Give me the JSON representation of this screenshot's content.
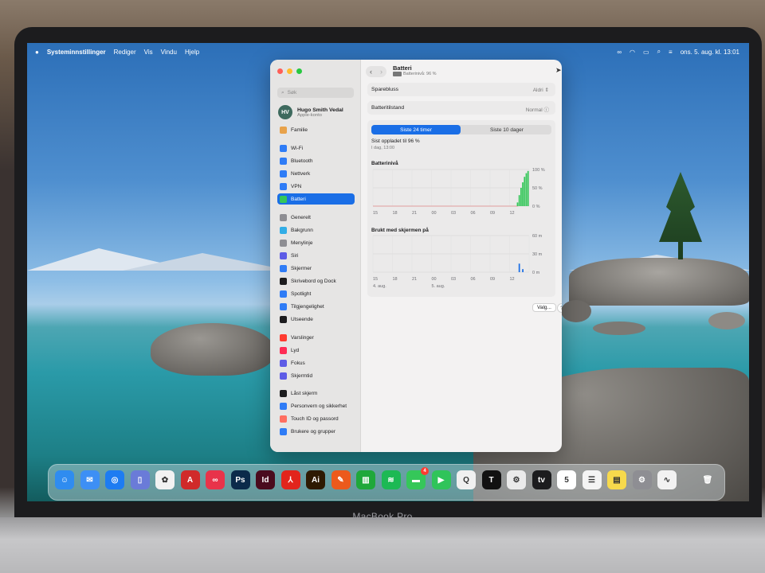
{
  "menubar": {
    "app_name": "Systeminnstillinger",
    "menus": [
      "Rediger",
      "Vis",
      "Vindu",
      "Hjelp"
    ],
    "datetime": "ons. 5. aug. kl. 13:01"
  },
  "sidebar": {
    "search_placeholder": "Søk",
    "user_name": "Hugo Smith Vedal",
    "user_sub": "Apple-konto",
    "avatar_initials": "HV",
    "items": [
      {
        "label": "Familie",
        "icon": "family-icon",
        "color": "#e8a24a"
      },
      {
        "label": "Wi-Fi",
        "icon": "wifi-icon",
        "color": "#2f7cf6"
      },
      {
        "label": "Bluetooth",
        "icon": "bluetooth-icon",
        "color": "#2f7cf6"
      },
      {
        "label": "Nettverk",
        "icon": "globe-icon",
        "color": "#2f7cf6"
      },
      {
        "label": "VPN",
        "icon": "vpn-icon",
        "color": "#2f7cf6"
      },
      {
        "label": "Batteri",
        "icon": "battery-icon",
        "color": "#34c759"
      },
      {
        "label": "Generelt",
        "icon": "gear-icon",
        "color": "#8e8e93"
      },
      {
        "label": "Bakgrunn",
        "icon": "wallpaper-icon",
        "color": "#32ade6"
      },
      {
        "label": "Menylinje",
        "icon": "menubar-icon",
        "color": "#8e8e93"
      },
      {
        "label": "Siri",
        "icon": "siri-icon",
        "color": "#5e5ce6"
      },
      {
        "label": "Skjermer",
        "icon": "display-icon",
        "color": "#2f7cf6"
      },
      {
        "label": "Skrivebord og Dock",
        "icon": "dock-icon",
        "color": "#1c1c1e"
      },
      {
        "label": "Spotlight",
        "icon": "spotlight-icon",
        "color": "#2f7cf6"
      },
      {
        "label": "Tilgjengelighet",
        "icon": "accessibility-icon",
        "color": "#2f7cf6"
      },
      {
        "label": "Utseende",
        "icon": "appearance-icon",
        "color": "#1c1c1e"
      },
      {
        "label": "Varslinger",
        "icon": "notifications-icon",
        "color": "#ff3b30"
      },
      {
        "label": "Lyd",
        "icon": "sound-icon",
        "color": "#ff2d55"
      },
      {
        "label": "Fokus",
        "icon": "focus-icon",
        "color": "#5e5ce6"
      },
      {
        "label": "Skjermtid",
        "icon": "screentime-icon",
        "color": "#5e5ce6"
      },
      {
        "label": "Låst skjerm",
        "icon": "lock-screen-icon",
        "color": "#1c1c1e"
      },
      {
        "label": "Personvern og sikkerhet",
        "icon": "privacy-icon",
        "color": "#2f7cf6"
      },
      {
        "label": "Touch ID og passord",
        "icon": "touchid-icon",
        "color": "#ff6f61"
      },
      {
        "label": "Brukere og grupper",
        "icon": "users-icon",
        "color": "#2f7cf6"
      }
    ]
  },
  "main": {
    "title": "Batteri",
    "subtitle": "Batterinivå: 96 %",
    "low_power_label": "Sparebluss",
    "low_power_value": "Aldri",
    "health_label": "Batteritilstand",
    "health_value": "Normal",
    "tab_24h": "Siste 24 timer",
    "tab_10d": "Siste 10 dager",
    "last_charged": "Sist oppladet til 96 %",
    "last_charged_time": "I dag, 13:00",
    "options_button": "Valg...",
    "help_button": "?"
  },
  "chart_data": [
    {
      "type": "bar",
      "title": "Batterinivå",
      "categories": [
        "15",
        "18",
        "21",
        "00",
        "03",
        "06",
        "09",
        "12"
      ],
      "yticks": [
        "100 %",
        "50 %",
        "0 %"
      ],
      "ylim": [
        0,
        100
      ],
      "series": [
        {
          "values": [
            0,
            0,
            0,
            0,
            0,
            0,
            0,
            0,
            0,
            0,
            0,
            0,
            0,
            0,
            0,
            0,
            0,
            0,
            0,
            0,
            0,
            0,
            0,
            0,
            0,
            0,
            0,
            0,
            0,
            0,
            0,
            0,
            0,
            0,
            0,
            0,
            0,
            0,
            0,
            0,
            0,
            0,
            0,
            0,
            0,
            0,
            0,
            0,
            0,
            0,
            0,
            0,
            0,
            0,
            0,
            0,
            0,
            0,
            0,
            0,
            0,
            0,
            0,
            0,
            0,
            0,
            0,
            0,
            0,
            0,
            0,
            0,
            0,
            0,
            0,
            0,
            0,
            0,
            0,
            0,
            0,
            0,
            10,
            30,
            50,
            65,
            80,
            90,
            96
          ]
        }
      ],
      "grid": true
    },
    {
      "type": "bar",
      "title": "Brukt med skjermen på",
      "categories": [
        "15",
        "18",
        "21",
        "00",
        "03",
        "06",
        "09",
        "12"
      ],
      "date_labels": [
        "4. aug.",
        "5. aug."
      ],
      "yticks": [
        "60 m",
        "30 m",
        "0 m"
      ],
      "ylim": [
        0,
        60
      ],
      "series": [
        {
          "values": [
            0,
            0,
            0,
            0,
            0,
            0,
            0,
            0,
            0,
            0,
            0,
            0,
            0,
            0,
            0,
            0,
            0,
            0,
            0,
            0,
            0,
            0,
            0,
            0,
            0,
            0,
            0,
            0,
            0,
            0,
            0,
            0,
            0,
            0,
            0,
            0,
            0,
            0,
            0,
            0,
            0,
            0,
            0,
            0,
            0,
            0,
            0,
            0,
            0,
            0,
            0,
            0,
            0,
            0,
            0,
            0,
            0,
            0,
            0,
            0,
            0,
            0,
            0,
            0,
            0,
            0,
            0,
            0,
            0,
            0,
            0,
            0,
            0,
            0,
            0,
            0,
            0,
            0,
            0,
            0,
            0,
            0,
            0,
            14,
            0,
            5,
            0,
            0,
            0
          ]
        }
      ],
      "grid": true
    }
  ],
  "dock": {
    "brand_text": "MacBook Pro",
    "apps": [
      {
        "name": "finder-icon",
        "glyph": "☺",
        "color": "#2f8cf0"
      },
      {
        "name": "mail-icon",
        "glyph": "✉",
        "color": "#3d8ff5"
      },
      {
        "name": "safari-icon",
        "glyph": "◎",
        "color": "#1d7cf2"
      },
      {
        "name": "preview-icon",
        "glyph": "▯",
        "color": "#6a7bd8"
      },
      {
        "name": "photos-icon",
        "glyph": "✿",
        "color": "#f2f2f2"
      },
      {
        "name": "acrobat-cad-icon",
        "glyph": "A",
        "color": "#d02a2a"
      },
      {
        "name": "creative-cloud-icon",
        "glyph": "∞",
        "color": "#e8334a"
      },
      {
        "name": "photoshop-icon",
        "glyph": "Ps",
        "color": "#0b2a4a"
      },
      {
        "name": "indesign-icon",
        "glyph": "Id",
        "color": "#4a0b1e"
      },
      {
        "name": "acrobat-icon",
        "glyph": "⅄",
        "color": "#e2241c"
      },
      {
        "name": "illustrator-icon",
        "glyph": "Ai",
        "color": "#2e1a02"
      },
      {
        "name": "pencil-app-icon",
        "glyph": "✎",
        "color": "#ec5a1c"
      },
      {
        "name": "numbers-icon",
        "glyph": "▥",
        "color": "#1fa83a"
      },
      {
        "name": "spotify-icon",
        "glyph": "≋",
        "color": "#1db954"
      },
      {
        "name": "messages-icon",
        "glyph": "▬",
        "color": "#35c759",
        "badge": "4"
      },
      {
        "name": "facetime-icon",
        "glyph": "▶",
        "color": "#30c45a"
      },
      {
        "name": "qgis-icon",
        "glyph": "Q",
        "color": "#f0f0f0"
      },
      {
        "name": "typeface-icon",
        "glyph": "T",
        "color": "#111111"
      },
      {
        "name": "photo-booth-icon",
        "glyph": "⚙",
        "color": "#eaeaea"
      },
      {
        "name": "apple-tv-icon",
        "glyph": "tv",
        "color": "#1c1c1e"
      },
      {
        "name": "calendar-icon",
        "glyph": "5",
        "color": "#ffffff"
      },
      {
        "name": "reminders-icon",
        "glyph": "☰",
        "color": "#f4f4f4"
      },
      {
        "name": "notes-icon",
        "glyph": "▤",
        "color": "#f7d94c"
      },
      {
        "name": "system-settings-icon",
        "glyph": "⚙",
        "color": "#8e8e93"
      },
      {
        "name": "freeform-icon",
        "glyph": "∿",
        "color": "#f2f2f2"
      },
      {
        "name": "trash-icon",
        "glyph": "🗑",
        "color": "transparent"
      }
    ]
  }
}
